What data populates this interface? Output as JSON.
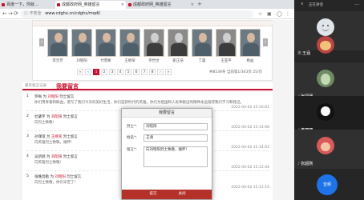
{
  "browser": {
    "tabs": [
      {
        "label": "百度一下，你就..."
      },
      {
        "label": "成都政府网_英雄留言"
      },
      {
        "label": "成都政府网_英雄留言"
      }
    ],
    "new_tab": "+",
    "nav_back": "←",
    "nav_forward": "→",
    "nav_reload": "⟳",
    "security": "ⓘ 不安全",
    "url": "www.cdghx.cn/cdghx/mqdl/"
  },
  "hero": {
    "names": [
      "李元芳",
      "刘昭阳",
      "代营彬",
      "王继荣",
      "罗世文",
      "崔正浩",
      "丁晨",
      "王亚平",
      "杨益"
    ],
    "prev": "‹",
    "next": "›",
    "pages": [
      "«",
      "‹",
      "1",
      "2",
      "3",
      "4",
      "5",
      "6",
      "7",
      "8",
      "›",
      "»"
    ],
    "page_info": "共8536条 当前第1/343页 25/页"
  },
  "crumb": "最近留言记录",
  "section_title": "我要留言",
  "entries": [
    {
      "num": "1",
      "name": "罗梅",
      "hero": "刘昭阳",
      "msg": "你们用青春和鲜血，谱写了我们今天的美好生活，你们是新时代的英雄，你们为祖国和人民奉献出的精神永远值得我们学习和铭记。",
      "time": "2022-04-02 15:16:01"
    },
    {
      "num": "2",
      "name": "杜肇宇",
      "hero": "刘昭阳",
      "msg": "向烈士致敬!",
      "time": "2022-04-02 15:14:08"
    },
    {
      "num": "3",
      "name": "孙瑾琪",
      "hero": "王继荣",
      "msg": "向英雄烈士致敬，缅怀!",
      "time": "2022-04-02 15:14:03"
    },
    {
      "num": "4",
      "name": "吴新刚",
      "hero": "刘昭阳",
      "msg": "向英雄烈士致敬!",
      "time": "2022-04-02 15:12:44"
    },
    {
      "num": "5",
      "name": "张维昌勤",
      "hero": "刘昭阳",
      "msg": "向烈士致敬，你们辛苦了!",
      "time": "2022-04-02 15:12:10"
    }
  ],
  "entry_to": "为",
  "entry_label": "烈士留言",
  "modal": {
    "title": "我要留言",
    "hero_label": "烈士*:",
    "hero_value": "刘昭阳",
    "name_label": "姓名*:",
    "name_value": "王涵",
    "msg_label": "留言*:",
    "msg_value": "向刘昭阳烈士致敬，缅怀!",
    "submit": "提交",
    "close": "关闭"
  },
  "side": {
    "title": "正在讲话",
    "caret": "∨",
    "more": "…",
    "participants": [
      {
        "name": "王涵",
        "prefix": "英"
      },
      {
        "name": "张贤瑾",
        "prefix": ""
      },
      {
        "name": "李丽丽",
        "prefix": ""
      },
      {
        "name": "张超刚",
        "prefix": ""
      }
    ],
    "action": "音频"
  },
  "colors": {
    "accent": "#c8102e",
    "meeting_bg": "#262626",
    "action_blue": "#1e73e8"
  }
}
